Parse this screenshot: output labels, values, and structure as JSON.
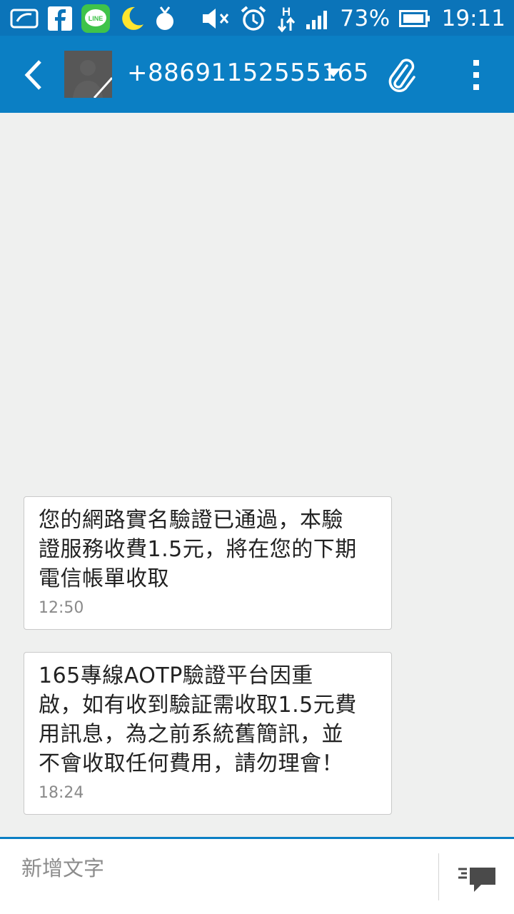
{
  "status_bar": {
    "notification_icons": [
      "cloud-check-icon",
      "facebook-icon",
      "line-icon",
      "moon-icon",
      "fruit-icon"
    ],
    "system_icons": [
      "mute-icon",
      "alarm-icon",
      "h-data-icon",
      "signal-icon"
    ],
    "battery_percent": "73%",
    "time": "19:11",
    "accent_color": "#0b74b9"
  },
  "app_bar": {
    "contact_number": "+88691152555165",
    "icons": [
      "back-arrow-icon",
      "avatar-icon",
      "dropdown-caret-icon",
      "paperclip-icon",
      "more-vert-icon"
    ],
    "color": "#0b7fc4"
  },
  "messages": [
    {
      "text": "您的網路實名驗證已通過，本驗\n證服務收費1.5元，將在您的下期\n電信帳單收取",
      "time": "12:50"
    },
    {
      "text": "165專線AOTP驗證平台因重\n啟，如有收到驗証需收取1.5元費\n用訊息，為之前系統舊簡訊，並\n不會收取任何費用，請勿理會！",
      "time": "18:24"
    }
  ],
  "composer": {
    "placeholder": "新增文字",
    "send_icon": "send-message-icon"
  }
}
